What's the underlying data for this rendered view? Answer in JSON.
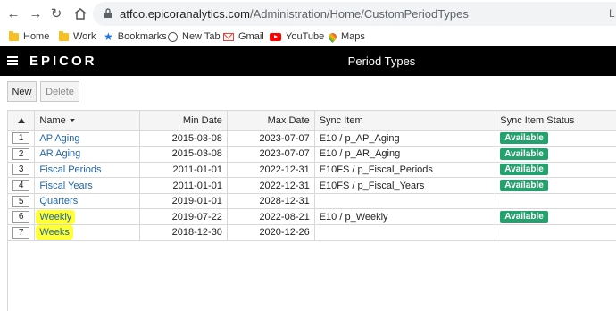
{
  "browser": {
    "url_host": "atfco.epicoranalytics.com",
    "url_path": "/Administration/Home/CustomPeriodTypes",
    "right_text": "L"
  },
  "bookmarks": [
    {
      "label": "Home",
      "icon": "folder-icon"
    },
    {
      "label": "Work",
      "icon": "folder-icon"
    },
    {
      "label": "Bookmarks",
      "icon": "star-icon"
    },
    {
      "label": "New Tab",
      "icon": "globe-icon"
    },
    {
      "label": "Gmail",
      "icon": "gmail-icon"
    },
    {
      "label": "YouTube",
      "icon": "youtube-icon"
    },
    {
      "label": "Maps",
      "icon": "maps-icon"
    }
  ],
  "header": {
    "logo": "EPICOR",
    "title": "Period Types"
  },
  "toolbar": {
    "new_label": "New",
    "delete_label": "Delete"
  },
  "grid": {
    "columns": {
      "name": "Name",
      "min_date": "Min Date",
      "max_date": "Max Date",
      "sync_item": "Sync Item",
      "sync_status": "Sync Item Status"
    },
    "rows": [
      {
        "num": "1",
        "name": "AP Aging",
        "min": "2015-03-08",
        "max": "2023-07-07",
        "sync": "E10 / p_AP_Aging",
        "status": "Available",
        "highlight": false
      },
      {
        "num": "2",
        "name": "AR Aging",
        "min": "2015-03-08",
        "max": "2023-07-07",
        "sync": "E10 / p_AR_Aging",
        "status": "Available",
        "highlight": false
      },
      {
        "num": "3",
        "name": "Fiscal Periods",
        "min": "2011-01-01",
        "max": "2022-12-31",
        "sync": "E10FS / p_Fiscal_Periods",
        "status": "Available",
        "highlight": false
      },
      {
        "num": "4",
        "name": "Fiscal Years",
        "min": "2011-01-01",
        "max": "2022-12-31",
        "sync": "E10FS / p_Fiscal_Years",
        "status": "Available",
        "highlight": false
      },
      {
        "num": "5",
        "name": "Quarters",
        "min": "2019-01-01",
        "max": "2028-12-31",
        "sync": "",
        "status": "",
        "highlight": false
      },
      {
        "num": "6",
        "name": "Weekly",
        "min": "2019-07-22",
        "max": "2022-08-21",
        "sync": "E10 / p_Weekly",
        "status": "Available",
        "highlight": true
      },
      {
        "num": "7",
        "name": "Weeks",
        "min": "2018-12-30",
        "max": "2020-12-26",
        "sync": "",
        "status": "",
        "highlight": true
      }
    ]
  },
  "colors": {
    "header_bg": "#000000",
    "status_badge": "#23a26d",
    "link": "#2266aa",
    "highlight": "#ffff33"
  }
}
